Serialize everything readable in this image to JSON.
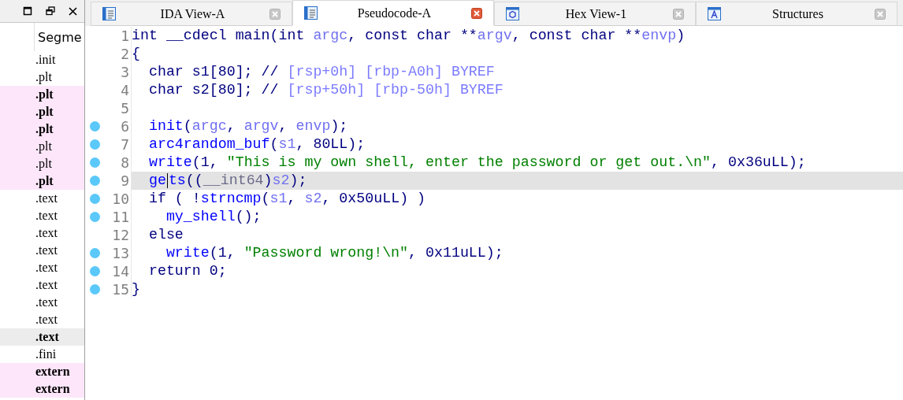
{
  "segments_panel": {
    "column_header": "Segme",
    "rows": [
      {
        "label": ".init",
        "bold": false,
        "highlighted": false,
        "selected": false
      },
      {
        "label": ".plt",
        "bold": false,
        "highlighted": false,
        "selected": false
      },
      {
        "label": ".plt",
        "bold": true,
        "highlighted": true,
        "selected": false
      },
      {
        "label": ".plt",
        "bold": true,
        "highlighted": true,
        "selected": false
      },
      {
        "label": ".plt",
        "bold": true,
        "highlighted": true,
        "selected": false
      },
      {
        "label": ".plt",
        "bold": false,
        "highlighted": true,
        "selected": false
      },
      {
        "label": ".plt",
        "bold": false,
        "highlighted": true,
        "selected": false
      },
      {
        "label": ".plt",
        "bold": true,
        "highlighted": true,
        "selected": false
      },
      {
        "label": ".text",
        "bold": false,
        "highlighted": false,
        "selected": false
      },
      {
        "label": ".text",
        "bold": false,
        "highlighted": false,
        "selected": false
      },
      {
        "label": ".text",
        "bold": false,
        "highlighted": false,
        "selected": false
      },
      {
        "label": ".text",
        "bold": false,
        "highlighted": false,
        "selected": false
      },
      {
        "label": ".text",
        "bold": false,
        "highlighted": false,
        "selected": false
      },
      {
        "label": ".text",
        "bold": false,
        "highlighted": false,
        "selected": false
      },
      {
        "label": ".text",
        "bold": false,
        "highlighted": false,
        "selected": false
      },
      {
        "label": ".text",
        "bold": false,
        "highlighted": false,
        "selected": false
      },
      {
        "label": ".text",
        "bold": true,
        "highlighted": false,
        "selected": true
      },
      {
        "label": ".fini",
        "bold": false,
        "highlighted": false,
        "selected": false
      },
      {
        "label": "extern",
        "bold": true,
        "highlighted": true,
        "selected": false
      },
      {
        "label": "extern",
        "bold": true,
        "highlighted": true,
        "selected": false
      }
    ]
  },
  "tabs": [
    {
      "label": "IDA View-A",
      "selected": false
    },
    {
      "label": "Pseudocode-A",
      "selected": true
    },
    {
      "label": "Hex View-1",
      "selected": false
    },
    {
      "label": "Structures",
      "selected": false
    }
  ],
  "code_lines": [
    {
      "number": "1",
      "breakpoint": false,
      "current": false,
      "tokens": [
        {
          "text": "int __cdecl main(int ",
          "kind": "plain"
        },
        {
          "text": "argc",
          "kind": "var"
        },
        {
          "text": ", const char **",
          "kind": "plain"
        },
        {
          "text": "argv",
          "kind": "var"
        },
        {
          "text": ", const char **",
          "kind": "plain"
        },
        {
          "text": "envp",
          "kind": "var"
        },
        {
          "text": ")",
          "kind": "plain"
        }
      ]
    },
    {
      "number": "2",
      "breakpoint": false,
      "current": false,
      "tokens": [
        {
          "text": "{",
          "kind": "plain"
        }
      ],
      "children": [
        {
          "number": "3",
          "breakpoint": false,
          "current": false,
          "tokens": [
            {
              "text": "char s1[80]; // ",
              "kind": "plain"
            },
            {
              "text": "[rsp+0h] [rbp-A0h] BYREF",
              "kind": "comment"
            }
          ]
        },
        {
          "number": "4",
          "breakpoint": false,
          "current": false,
          "tokens": [
            {
              "text": "char s2[80]; // ",
              "kind": "plain"
            },
            {
              "text": "[rsp+50h] [rbp-50h] BYREF",
              "kind": "comment"
            }
          ]
        },
        {
          "number": "5",
          "breakpoint": false,
          "current": false
        },
        {
          "number": "6",
          "breakpoint": true,
          "current": false,
          "tokens": [
            {
              "text": "init",
              "kind": "func"
            },
            {
              "text": "(",
              "kind": "plain"
            },
            {
              "text": "argc",
              "kind": "var"
            },
            {
              "text": ", ",
              "kind": "plain"
            },
            {
              "text": "argv",
              "kind": "var"
            },
            {
              "text": ", ",
              "kind": "plain"
            },
            {
              "text": "envp",
              "kind": "var"
            },
            {
              "text": ");",
              "kind": "plain"
            }
          ]
        },
        {
          "number": "7",
          "breakpoint": true,
          "current": false,
          "tokens": [
            {
              "text": "arc4random_buf",
              "kind": "func"
            },
            {
              "text": "(",
              "kind": "plain"
            },
            {
              "text": "s1",
              "kind": "var"
            },
            {
              "text": ", 80LL);",
              "kind": "plain"
            }
          ]
        },
        {
          "number": "8",
          "breakpoint": true,
          "current": false,
          "tokens": [
            {
              "text": "write",
              "kind": "func"
            },
            {
              "text": "(1, ",
              "kind": "plain"
            },
            {
              "text": "\"This is my own shell, enter the password or get out.\\n\"",
              "kind": "string"
            },
            {
              "text": ", 0x36uLL);",
              "kind": "plain"
            }
          ]
        },
        {
          "number": "9",
          "breakpoint": true,
          "current": true,
          "tokens": [
            {
              "text": "ge",
              "kind": "func",
              "caret_after": true
            },
            {
              "text": "ts",
              "kind": "func"
            },
            {
              "text": "((",
              "kind": "plain"
            },
            {
              "text": "__int64",
              "kind": "cast"
            },
            {
              "text": ")",
              "kind": "plain"
            },
            {
              "text": "s2",
              "kind": "var"
            },
            {
              "text": ");",
              "kind": "plain"
            }
          ]
        },
        {
          "number": "10",
          "breakpoint": true,
          "current": false,
          "tokens": [
            {
              "text": "if ( !",
              "kind": "plain"
            },
            {
              "text": "strncmp",
              "kind": "func"
            },
            {
              "text": "(",
              "kind": "plain"
            },
            {
              "text": "s1",
              "kind": "var"
            },
            {
              "text": ", ",
              "kind": "plain"
            },
            {
              "text": "s2",
              "kind": "var"
            },
            {
              "text": ", 0x50uLL) )",
              "kind": "plain"
            }
          ],
          "children": [
            {
              "number": "11",
              "breakpoint": true,
              "current": false,
              "tokens": [
                {
                  "text": "my_shell",
                  "kind": "func"
                },
                {
                  "text": "();",
                  "kind": "plain"
                }
              ]
            }
          ]
        },
        {
          "number": "12",
          "breakpoint": false,
          "current": false,
          "tokens": [
            {
              "text": "else",
              "kind": "plain"
            }
          ],
          "children": [
            {
              "number": "13",
              "breakpoint": true,
              "current": false,
              "tokens": [
                {
                  "text": "write",
                  "kind": "func"
                },
                {
                  "text": "(1, ",
                  "kind": "plain"
                },
                {
                  "text": "\"Password wrong!\\n\"",
                  "kind": "string"
                },
                {
                  "text": ", 0x11uLL);",
                  "kind": "plain"
                }
              ]
            }
          ]
        },
        {
          "number": "14",
          "breakpoint": true,
          "current": false,
          "tokens": [
            {
              "text": "return 0;",
              "kind": "plain"
            }
          ]
        }
      ]
    },
    {
      "number": "15",
      "breakpoint": true,
      "current": false,
      "tokens": [
        {
          "text": "}",
          "kind": "plain"
        }
      ]
    }
  ]
}
